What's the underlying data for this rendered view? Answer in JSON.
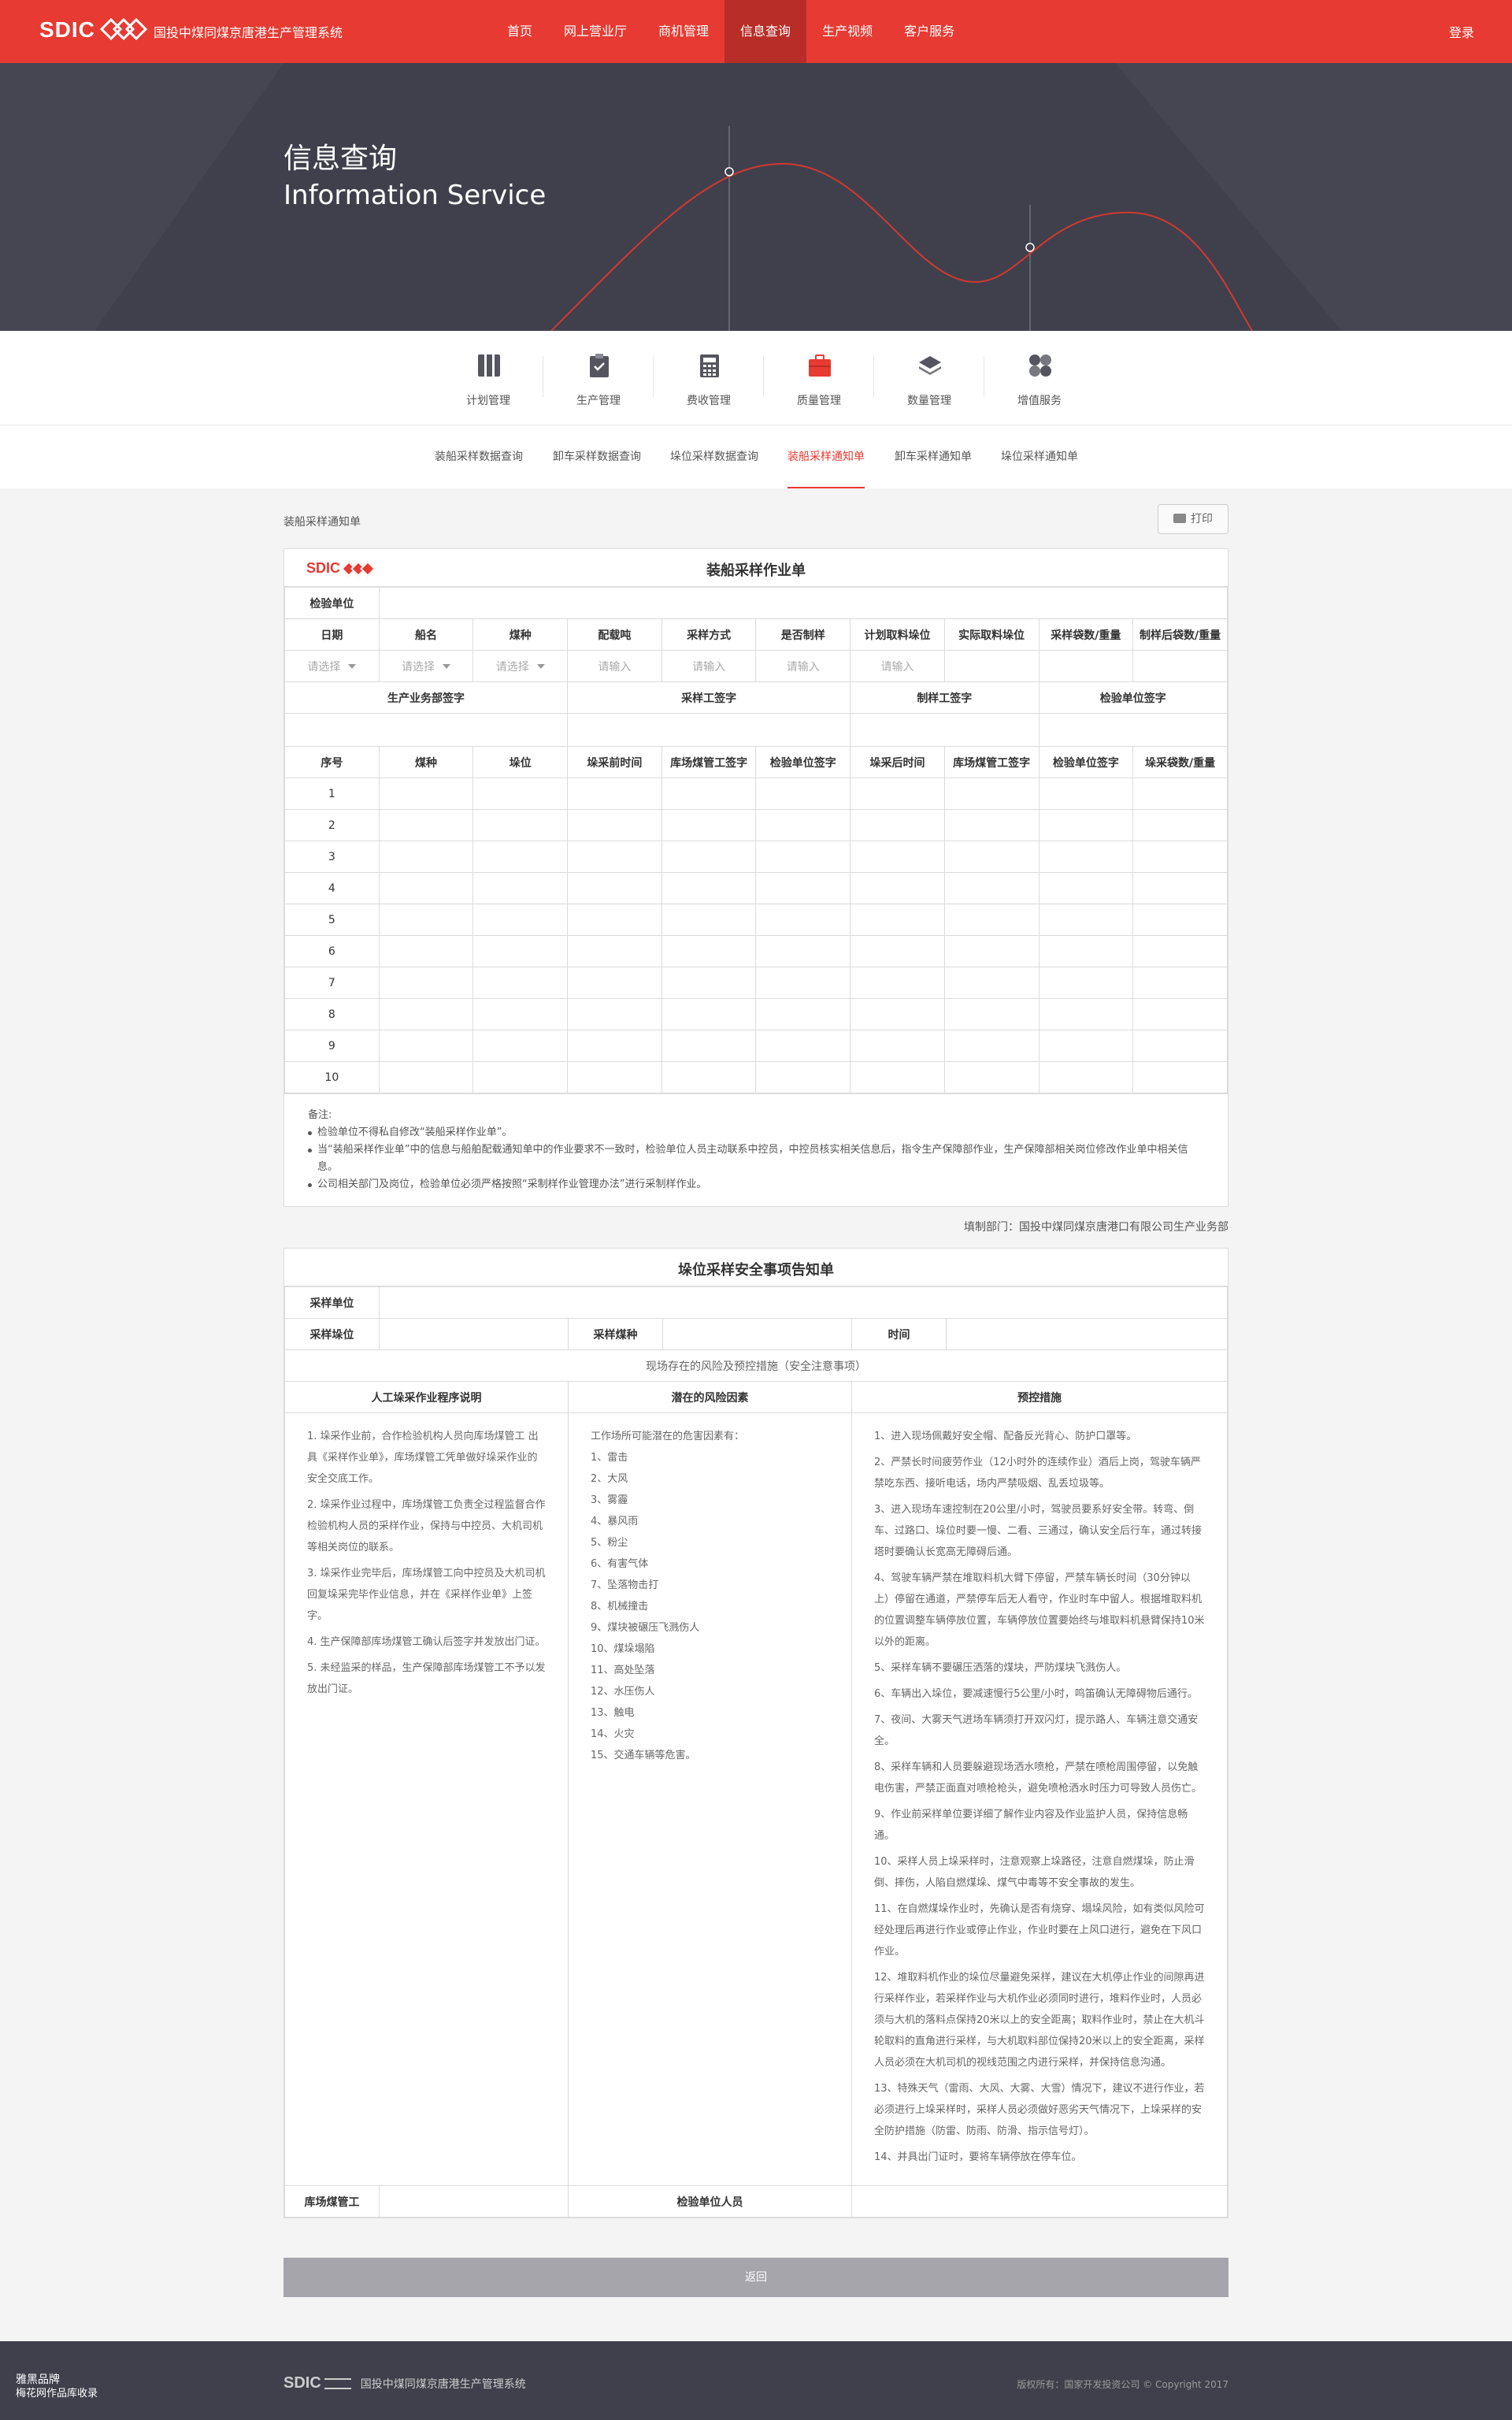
{
  "header": {
    "logo": "SDIC",
    "system_title": "国投中煤同煤京唐港生产管理系统",
    "login": "登录",
    "nav": [
      {
        "label": "首页"
      },
      {
        "label": "网上营业厅"
      },
      {
        "label": "商机管理"
      },
      {
        "label": "信息查询",
        "active": true
      },
      {
        "label": "生产视频"
      },
      {
        "label": "客户服务"
      }
    ]
  },
  "hero": {
    "title_cn": "信息查询",
    "title_en": "Information Service"
  },
  "icon_nav": [
    {
      "label": "计划管理",
      "icon": "binder-icon"
    },
    {
      "label": "生产管理",
      "icon": "clipboard-check-icon"
    },
    {
      "label": "费收管理",
      "icon": "calculator-icon"
    },
    {
      "label": "质量管理",
      "icon": "briefcase-icon",
      "active": true
    },
    {
      "label": "数量管理",
      "icon": "layers-icon"
    },
    {
      "label": "增值服务",
      "icon": "grid-icon"
    }
  ],
  "sub_tabs": [
    {
      "label": "装船采样数据查询"
    },
    {
      "label": "卸车采样数据查询"
    },
    {
      "label": "垛位采样数据查询"
    },
    {
      "label": "装船采样通知单",
      "active": true
    },
    {
      "label": "卸车采样通知单"
    },
    {
      "label": "垛位采样通知单"
    }
  ],
  "breadcrumb": "装船采样通知单",
  "print_label": "打印",
  "form1": {
    "logo": "SDIC",
    "title": "装船采样作业单",
    "inspection_unit_label": "检验单位",
    "headers": [
      "日期",
      "船名",
      "煤种",
      "配载吨",
      "采样方式",
      "是否制样",
      "计划取料垛位",
      "实际取料垛位",
      "采样袋数/重量",
      "制样后袋数/重量"
    ],
    "select_placeholder": "请选择",
    "input_placeholder": "请输入",
    "signatures": [
      "生产业务部签字",
      "采样工签字",
      "制样工签字",
      "检验单位签字"
    ],
    "row_headers": [
      "序号",
      "煤种",
      "垛位",
      "垛采前时间",
      "库场煤管工签字",
      "检验单位签字",
      "垛采后时间",
      "库场煤管工签字",
      "检验单位签字",
      "垛采袋数/重量"
    ],
    "rows": [
      "1",
      "2",
      "3",
      "4",
      "5",
      "6",
      "7",
      "8",
      "9",
      "10"
    ],
    "notes_title": "备注:",
    "notes": [
      "检验单位不得私自修改“装船采样作业单”。",
      "当“装船采样作业单”中的信息与船舶配载通知单中的作业要求不一致时，检验单位人员主动联系中控员，中控员核实相关信息后，指令生产保障部作业，生产保障部相关岗位修改作业单中相关信息。",
      "公司相关部门及岗位，检验单位必须严格按照“采制样作业管理办法”进行采制样作业。"
    ]
  },
  "dept": "填制部门：国投中煤同煤京唐港口有限公司生产业务部",
  "form2": {
    "title": "垛位采样安全事项告知单",
    "sampling_unit_label": "采样单位",
    "pile_label": "采样垛位",
    "coal_label": "采样煤种",
    "time_label": "时间",
    "risk_caption": "现场存在的风险及预控措施（安全注意事项）",
    "col_headers": [
      "人工垛采作业程序说明",
      "潜在的风险因素",
      "预控措施"
    ],
    "procedures": [
      "1. 垛采作业前，合作检验机构人员向库场煤管工 出具《采样作业单》，库场煤管工凭单做好垛采作业的安全交底工作。",
      "2. 垛采作业过程中，库场煤管工负责全过程监督合作检验机构人员的采样作业，保持与中控员、大机司机等相关岗位的联系。",
      "3. 垛采作业完毕后，库场煤管工向中控员及大机司机回复垛采完毕作业信息，并在《采样作业单》上签字。",
      "4. 生产保障部库场煤管工确认后签字并发放出门证。",
      "5. 未经监采的样品，生产保障部库场煤管工不予以发放出门证。"
    ],
    "risks_intro": "工作场所可能潜在的危害因素有：",
    "risks": [
      "1、雷击",
      "2、大风",
      "3、雾霾",
      "4、暴风雨",
      "5、粉尘",
      "6、有害气体",
      "7、坠落物击打",
      "8、机械撞击",
      "9、煤块被碾压飞溅伤人",
      "10、煤垛塌陷",
      "11、高处坠落",
      "12、水压伤人",
      "13、触电",
      "14、火灾",
      "15、交通车辆等危害。"
    ],
    "measures": [
      "1、进入现场佩戴好安全帽、配备反光背心、防护口罩等。",
      "2、严禁长时间疲劳作业（12小时外的连续作业）酒后上岗，驾驶车辆严禁吃东西、接听电话，场内严禁吸烟、乱丢垃圾等。",
      "3、进入现场车速控制在20公里/小时，驾驶员要系好安全带。转弯、倒车、过路口、垛位时要一慢、二看、三通过，确认安全后行车，通过转接塔时要确认长宽高无障碍后通。",
      "4、驾驶车辆严禁在堆取料机大臂下停留，严禁车辆长时间（30分钟以上）停留在通道，严禁停车后无人看守，作业时车中留人。根据堆取料机的位置调整车辆停放位置，车辆停放位置要始终与堆取料机悬臂保持10米以外的距离。",
      "5、采样车辆不要碾压洒落的煤块，严防煤块飞溅伤人。",
      "6、车辆出入垛位，要减速慢行5公里/小时，鸣笛确认无障碍物后通行。",
      "7、夜间、大雾天气进场车辆须打开双闪灯，提示路人、车辆注意交通安全。",
      "8、采样车辆和人员要躲避现场洒水喷枪，严禁在喷枪周围停留，以免触电伤害，严禁正面直对喷枪枪头，避免喷枪洒水时压力可导致人员伤亡。",
      "9、作业前采样单位要详细了解作业内容及作业监护人员，保持信息畅通。",
      "10、采样人员上垛采样时，注意观察上垛路径，注意自燃煤垛，防止滑倒、摔伤，人陷自燃煤垛、煤气中毒等不安全事故的发生。",
      "11、在自燃煤垛作业时，先确认是否有烧穿、塌垛风险，如有类似风险可经处理后再进行作业或停止作业，作业时要在上风口进行，避免在下风口作业。",
      "12、堆取料机作业的垛位尽量避免采样，建议在大机停止作业的间隙再进行采样作业，若采样作业与大机作业必须同时进行，堆料作业时，人员必须与大机的落料点保持20米以上的安全距离；取料作业时，禁止在大机斗轮取料的直角进行采样，与大机取料部位保持20米以上的安全距离，采样人员必须在大机司机的视线范围之内进行采样，并保持信息沟通。",
      "13、特殊天气（雷雨、大风、大雾、大雪）情况下，建议不进行作业，若必须进行上垛采样时，采样人员必须做好恶劣天气情况下，上垛采样的安全防护措施（防雷、防雨、防滑、指示信号灯）。",
      "14、并具出门证时，要将车辆停放在停车位。"
    ],
    "keeper_label": "库场煤管工",
    "inspector_label": "检验单位人员"
  },
  "back_label": "返回",
  "footer": {
    "logo": "SDIC",
    "title": "国投中煤同煤京唐港生产管理系统",
    "copyright": "版权所有：国家开发投资公司 © Copyright 2017",
    "brand_line1": "雅黑品牌",
    "brand_line2": "梅花网作品库收录"
  }
}
